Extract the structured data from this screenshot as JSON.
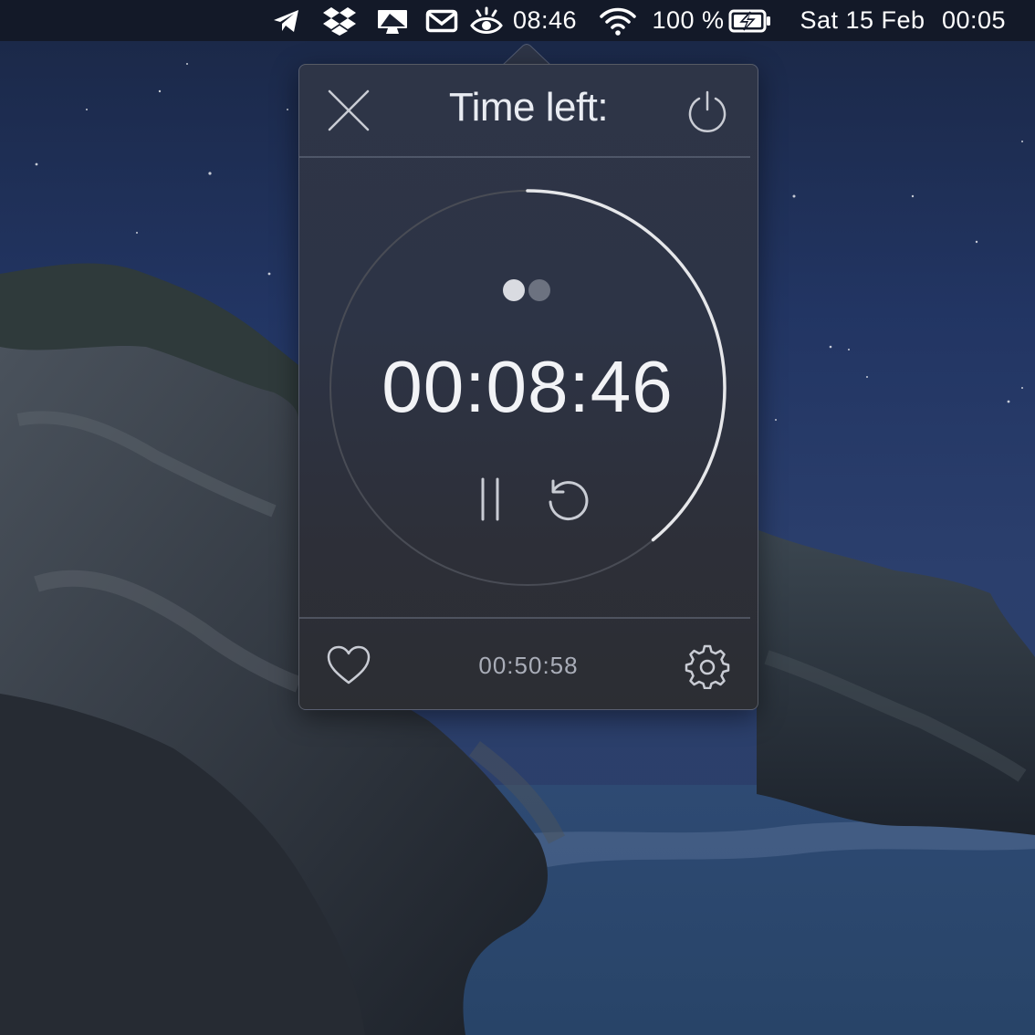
{
  "menubar": {
    "icons": [
      "telegram-icon",
      "dropbox-icon",
      "display-icon",
      "mail-icon",
      "eye-icon"
    ],
    "timer_readout": "08:46",
    "wifi_icon": "wifi-icon",
    "battery_percent": "100 %",
    "battery_icon": "battery-charging-icon",
    "date": "Sat 15 Feb",
    "clock": "00:05"
  },
  "popover": {
    "title": "Time left:",
    "close_icon": "close-icon",
    "power_icon": "power-icon",
    "session_dots": {
      "total": 2,
      "active": 1
    },
    "countdown": "00:08:46",
    "progress_fraction": 0.39,
    "controls": {
      "pause_icon": "pause-icon",
      "reset_icon": "reset-icon"
    },
    "footer": {
      "favorite_icon": "heart-icon",
      "total_time": "00:50:58",
      "settings_icon": "gear-icon"
    }
  },
  "colors": {
    "menubar_bg": "#12182a",
    "popover_bg": "#2d3446",
    "ring_progress": "#e6e7ea",
    "ring_track": "#494c55",
    "text_primary": "#f2f3f6",
    "text_secondary": "#a9adb8"
  }
}
